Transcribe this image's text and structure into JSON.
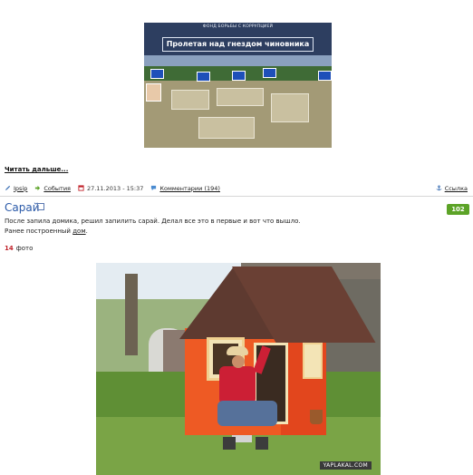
{
  "teaser": {
    "banner_org": "ФОНД БОРЬБЫ С КОРРУПЦИЕЙ",
    "banner_title": "Пролетая над гнездом чиновника",
    "read_more": "Читать дальше..."
  },
  "meta": {
    "author": "Ipsip",
    "category": "События",
    "datetime": "27.11.2013 - 15:37",
    "comments": "Комментарии (194)",
    "link": "Ссылка"
  },
  "post": {
    "title": "Сарай",
    "rating": "102",
    "desc_line1": "После запила домика, решил запилить сарай. Делал все это в первые и вот что вышло.",
    "desc_line2_prefix": "Ранее построенный ",
    "desc_line2_link": "дом",
    "desc_line2_suffix": ".",
    "photo_count": "14",
    "photo_label": "фото",
    "watermark": "YAPLAKAL.COM"
  },
  "colors": {
    "title_blue": "#2a59a8",
    "rating_green": "#5ca327",
    "count_red": "#c0222a"
  }
}
